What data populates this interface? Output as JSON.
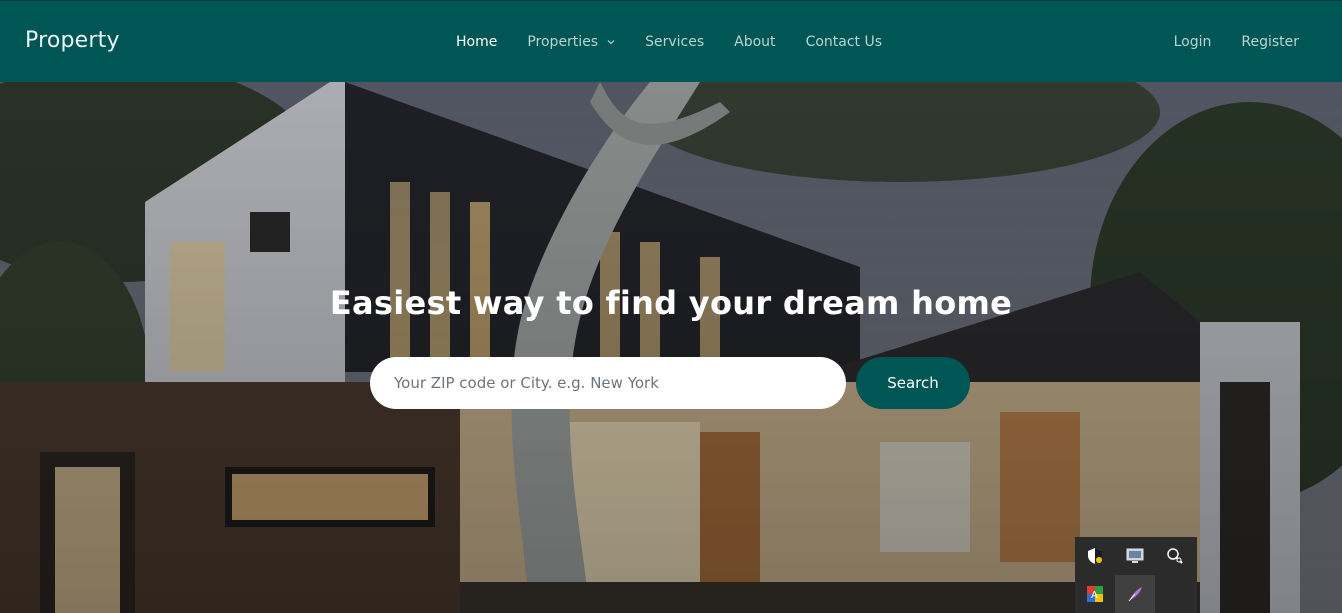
{
  "navbar": {
    "brand": "Property",
    "links": [
      {
        "label": "Home",
        "active": true
      },
      {
        "label": "Properties",
        "dropdown": true
      },
      {
        "label": "Services"
      },
      {
        "label": "About"
      },
      {
        "label": "Contact Us"
      }
    ],
    "auth": {
      "login": "Login",
      "register": "Register"
    }
  },
  "hero": {
    "headline": "Easiest way to find your dream home",
    "search_placeholder": "Your ZIP code or City. e.g. New York",
    "search_value": "",
    "search_button": "Search"
  },
  "colors": {
    "accent": "#005555",
    "nav_text": "#b9d4d2",
    "active_text": "#ffffff"
  },
  "system_tray": {
    "icons": [
      "security-shield-icon",
      "monitor-icon",
      "network-icon",
      "color-app-icon",
      "feather-pen-icon"
    ]
  }
}
